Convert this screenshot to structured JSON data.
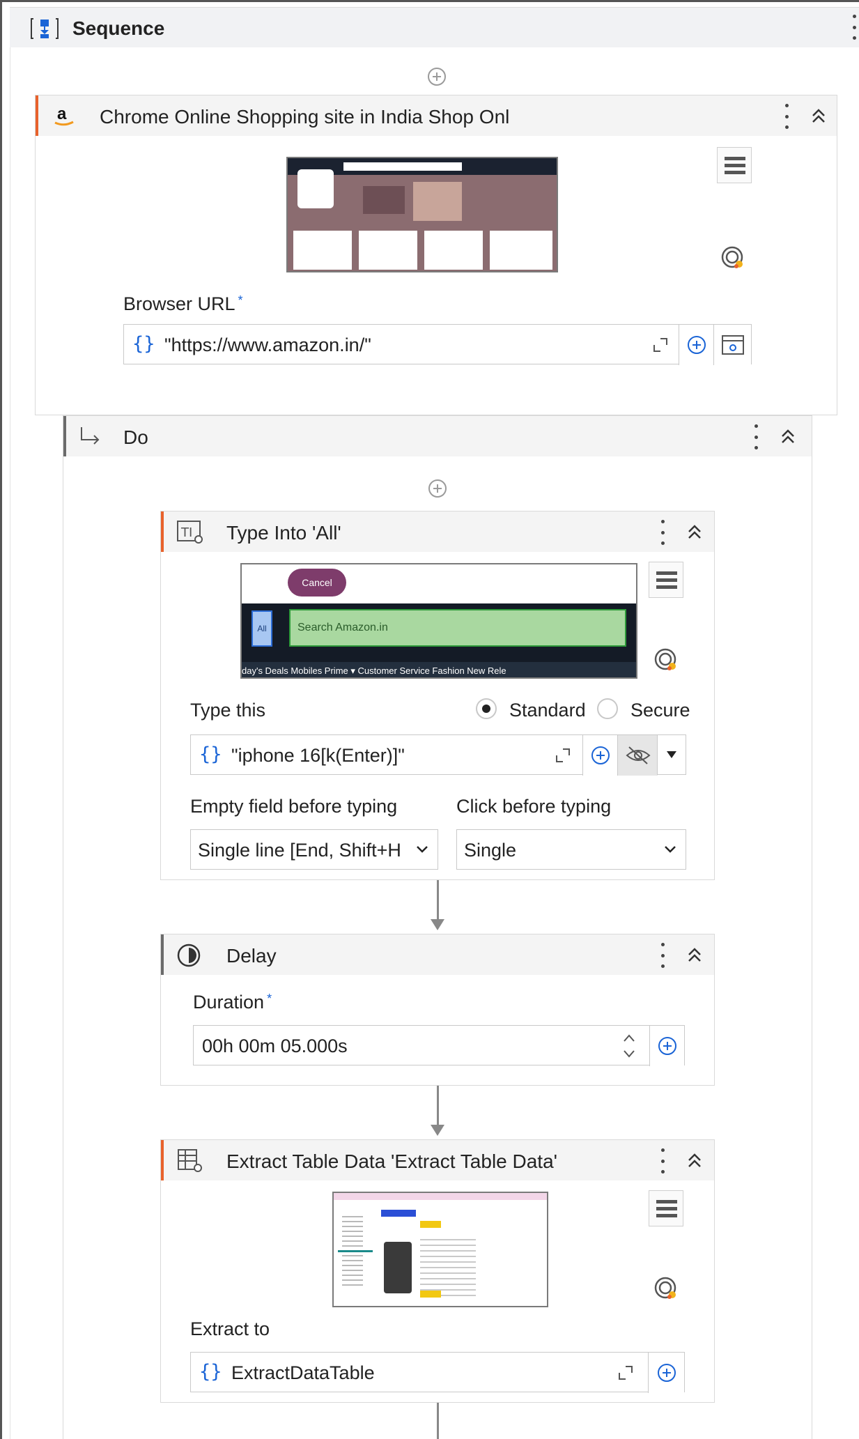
{
  "sequence": {
    "title": "Sequence"
  },
  "browser_activity": {
    "title": "Chrome Online Shopping site in India Shop Onl",
    "url_label": "Browser URL",
    "url_value": "\"https://www.amazon.in/\""
  },
  "do_block": {
    "title": "Do"
  },
  "type_into": {
    "title": "Type Into 'All'",
    "thumb_cancel": "Cancel",
    "thumb_search": "Search Amazon.in",
    "thumb_all": "All",
    "thumb_nav": "day's Deals   Mobiles   Prime ▾   Customer Service   Fashion   New Rele",
    "type_this_label": "Type this",
    "mode_standard": "Standard",
    "mode_secure": "Secure",
    "text_value": "\"iphone 16[k(Enter)]\"",
    "empty_field_label": "Empty field before typing",
    "empty_field_value": "Single line [End, Shift+H",
    "click_label": "Click before typing",
    "click_value": "Single"
  },
  "delay": {
    "title": "Delay",
    "duration_label": "Duration",
    "duration_value": "00h 00m 05.000s"
  },
  "extract": {
    "title": "Extract Table Data 'Extract Table Data'",
    "extract_label": "Extract to",
    "extract_value": "ExtractDataTable"
  },
  "colors": {
    "accent_orange": "#e8622c",
    "accent_gray": "#6b6b6b",
    "link_blue": "#1a64d6"
  }
}
